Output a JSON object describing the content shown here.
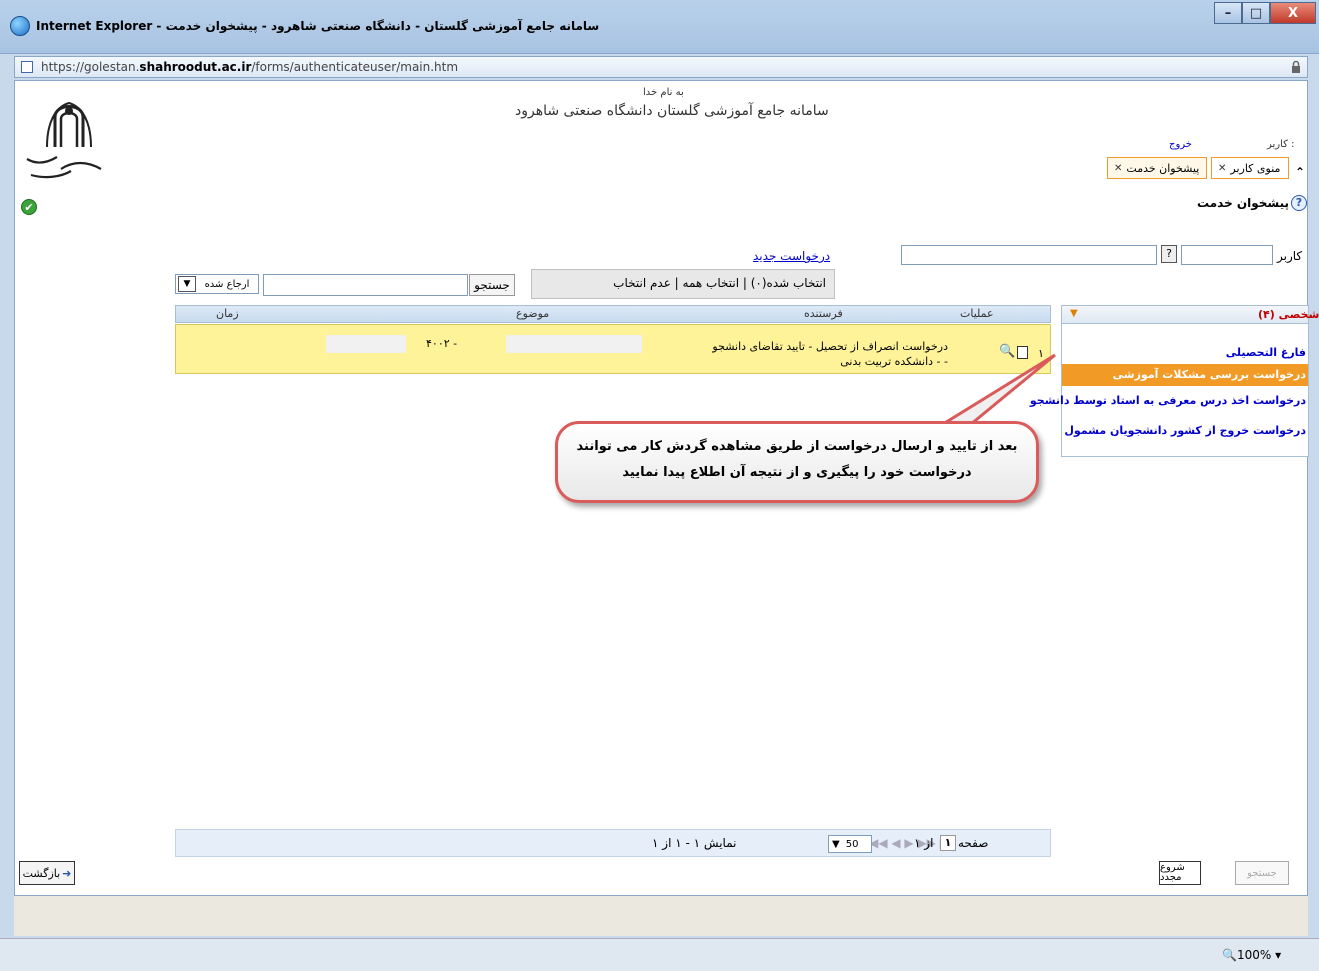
{
  "window": {
    "title": "Internet Explorer - سامانه جامع آموزشی گلستان - دانشگاه صنعتی شاهرود - پیشخوان خدمت",
    "min": "–",
    "max": "□",
    "close": "X"
  },
  "address": {
    "prefix": "https://golestan.",
    "domain": "shahroodut.ac.ir",
    "path": "/forms/authenticateuser/main.htm"
  },
  "header": {
    "basmala": "به نام خدا",
    "title": "سامانه جامع آموزشی گلستان    دانشگاه صنعتی شاهرود",
    "user_label": "کاربر :",
    "logout": "خروج"
  },
  "tabs": [
    {
      "label": "منوی کاربر"
    },
    {
      "label": "پیشخوان خدمت"
    }
  ],
  "page": {
    "heading": "پیشخوان خدمت"
  },
  "filter": {
    "user_label": "کاربر",
    "lookup": "?",
    "new_request": "درخواست جدید",
    "selection": "انتخاب شده(۰) | انتخاب همه | عدم انتخاب",
    "search_btn": "جستجو",
    "status": "ارجاع شده"
  },
  "table": {
    "columns": [
      "عملیات",
      "فرستنده",
      "موضوع",
      "زمان"
    ],
    "rows": [
      {
        "num": "۱",
        "subject": "درخواست انصراف از تحصیل - تایید تقاضای دانشجو - - دانشکده تربیت بدنی",
        "time": "- ۴۰۰۲"
      }
    ]
  },
  "sidebar": {
    "title": "شخصی (۴)",
    "items": [
      {
        "label": "فارغ التحصیلی"
      },
      {
        "label": "درخواست بررسی مشکلات آموزشی"
      },
      {
        "label": "درخواست اخذ درس معرفی به استاد توسط دانشجو"
      },
      {
        "label": "درخواست خروج از کشور دانشجویان مشمول"
      }
    ]
  },
  "callout": {
    "line1": "بعد از تایید و ارسال درخواست از طریق مشاهده گردش کار می توانند",
    "line2": "درخواست خود را پیگیری و از نتیجه آن اطلاع پیدا نمایید"
  },
  "pager": {
    "page_label": "صفحه",
    "page": "۱",
    "of": "از ۱",
    "size": "50",
    "summary": "نمایش ۱ - ۱ از ۱",
    "nav": "|◀ ◀◀ ◀   ▶ ▶▶ ▶|"
  },
  "buttons": {
    "back": "بازگشت",
    "reset": "شروع مجدد",
    "search": "جستجو"
  },
  "status": {
    "zoom": "100%"
  },
  "colors": {
    "accent": "#f29a26",
    "row_highlight": "#fff399",
    "link": "#0000cc"
  }
}
